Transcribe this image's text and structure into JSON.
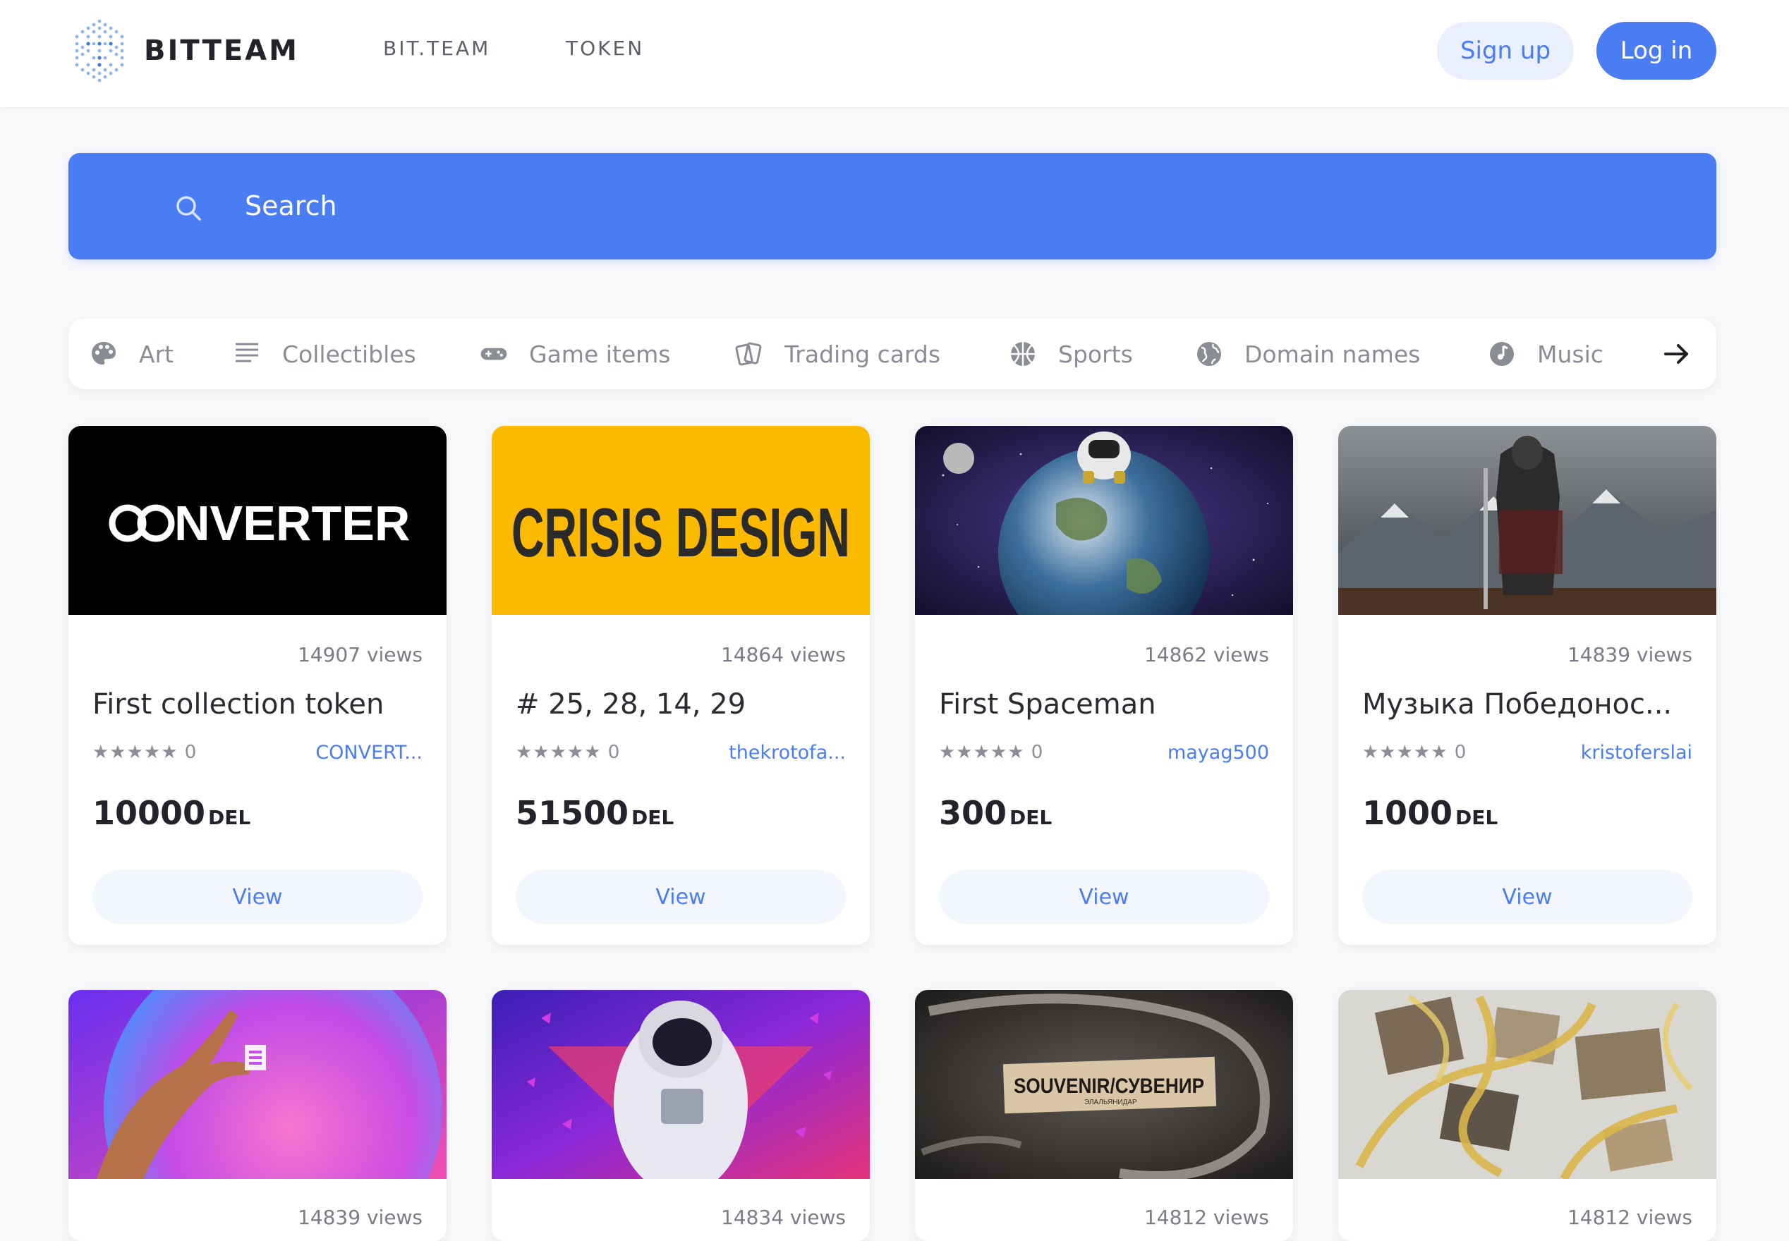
{
  "header": {
    "logo_text": "BITTEAM",
    "nav": [
      {
        "label": "BIT.TEAM"
      },
      {
        "label": "TOKEN"
      }
    ],
    "signup_label": "Sign up",
    "login_label": "Log in"
  },
  "search": {
    "placeholder": "Search"
  },
  "categories": [
    {
      "label": "Art",
      "icon": "palette-icon"
    },
    {
      "label": "Collectibles",
      "icon": "list-icon"
    },
    {
      "label": "Game items",
      "icon": "gamepad-icon"
    },
    {
      "label": "Trading cards",
      "icon": "cards-icon"
    },
    {
      "label": "Sports",
      "icon": "basketball-icon"
    },
    {
      "label": "Domain names",
      "icon": "globe-icon"
    },
    {
      "label": "Music",
      "icon": "music-icon"
    }
  ],
  "cards": [
    {
      "views": "14907 views",
      "title": "First collection token",
      "stars": "★★★★★ 0",
      "author": "CONVERT...",
      "price": "10000",
      "currency": "DEL",
      "view_label": "View",
      "image": "converter-logo"
    },
    {
      "views": "14864 views",
      "title": "# 25, 28, 14, 29",
      "stars": "★★★★★ 0",
      "author": "thekrotofa...",
      "price": "51500",
      "currency": "DEL",
      "view_label": "View",
      "image": "crisis-design-logo"
    },
    {
      "views": "14862 views",
      "title": "First Spaceman",
      "stars": "★★★★★ 0",
      "author": "mayag500",
      "price": "300",
      "currency": "DEL",
      "view_label": "View",
      "image": "spaceman-earth"
    },
    {
      "views": "14839 views",
      "title": "Музыка Победонос...",
      "stars": "★★★★★ 0",
      "author": "kristoferslai",
      "price": "1000",
      "currency": "DEL",
      "view_label": "View",
      "image": "knight-mountains"
    },
    {
      "views": "14839 views",
      "image": "hand-token"
    },
    {
      "views": "14834 views",
      "image": "astronaut-butterflies"
    },
    {
      "views": "14812 views",
      "image": "souvenir-label"
    },
    {
      "views": "14812 views",
      "image": "gold-collage"
    }
  ],
  "images": {
    "converter_text": "NVERTER",
    "crisis_text": "CRISIS DESIGN",
    "souvenir_text": "SOUVENIR/СУВЕНИР",
    "souvenir_sub": "ЭЛАЛЬЯНИДАР"
  },
  "colors": {
    "accent": "#4a7cf4",
    "accent_light": "#e9effd",
    "background": "#f7f8fa",
    "crisis_yellow": "#fbb900"
  }
}
